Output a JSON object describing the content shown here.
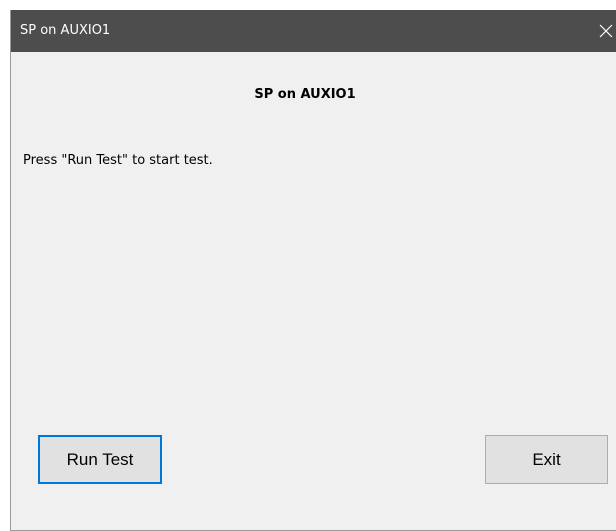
{
  "window": {
    "title": "SP on AUXIO1",
    "close_label": "×"
  },
  "content": {
    "heading": "SP on AUXIO1",
    "message": "Press \"Run Test\" to start test."
  },
  "buttons": {
    "run_test": "Run Test",
    "exit": "Exit"
  },
  "colors": {
    "titlebar": "#4d4d4d",
    "window_bg": "#f0f0f0",
    "button_bg": "#e1e1e1",
    "focus_border": "#0078d7"
  },
  "icons": {
    "close": "close-icon"
  }
}
